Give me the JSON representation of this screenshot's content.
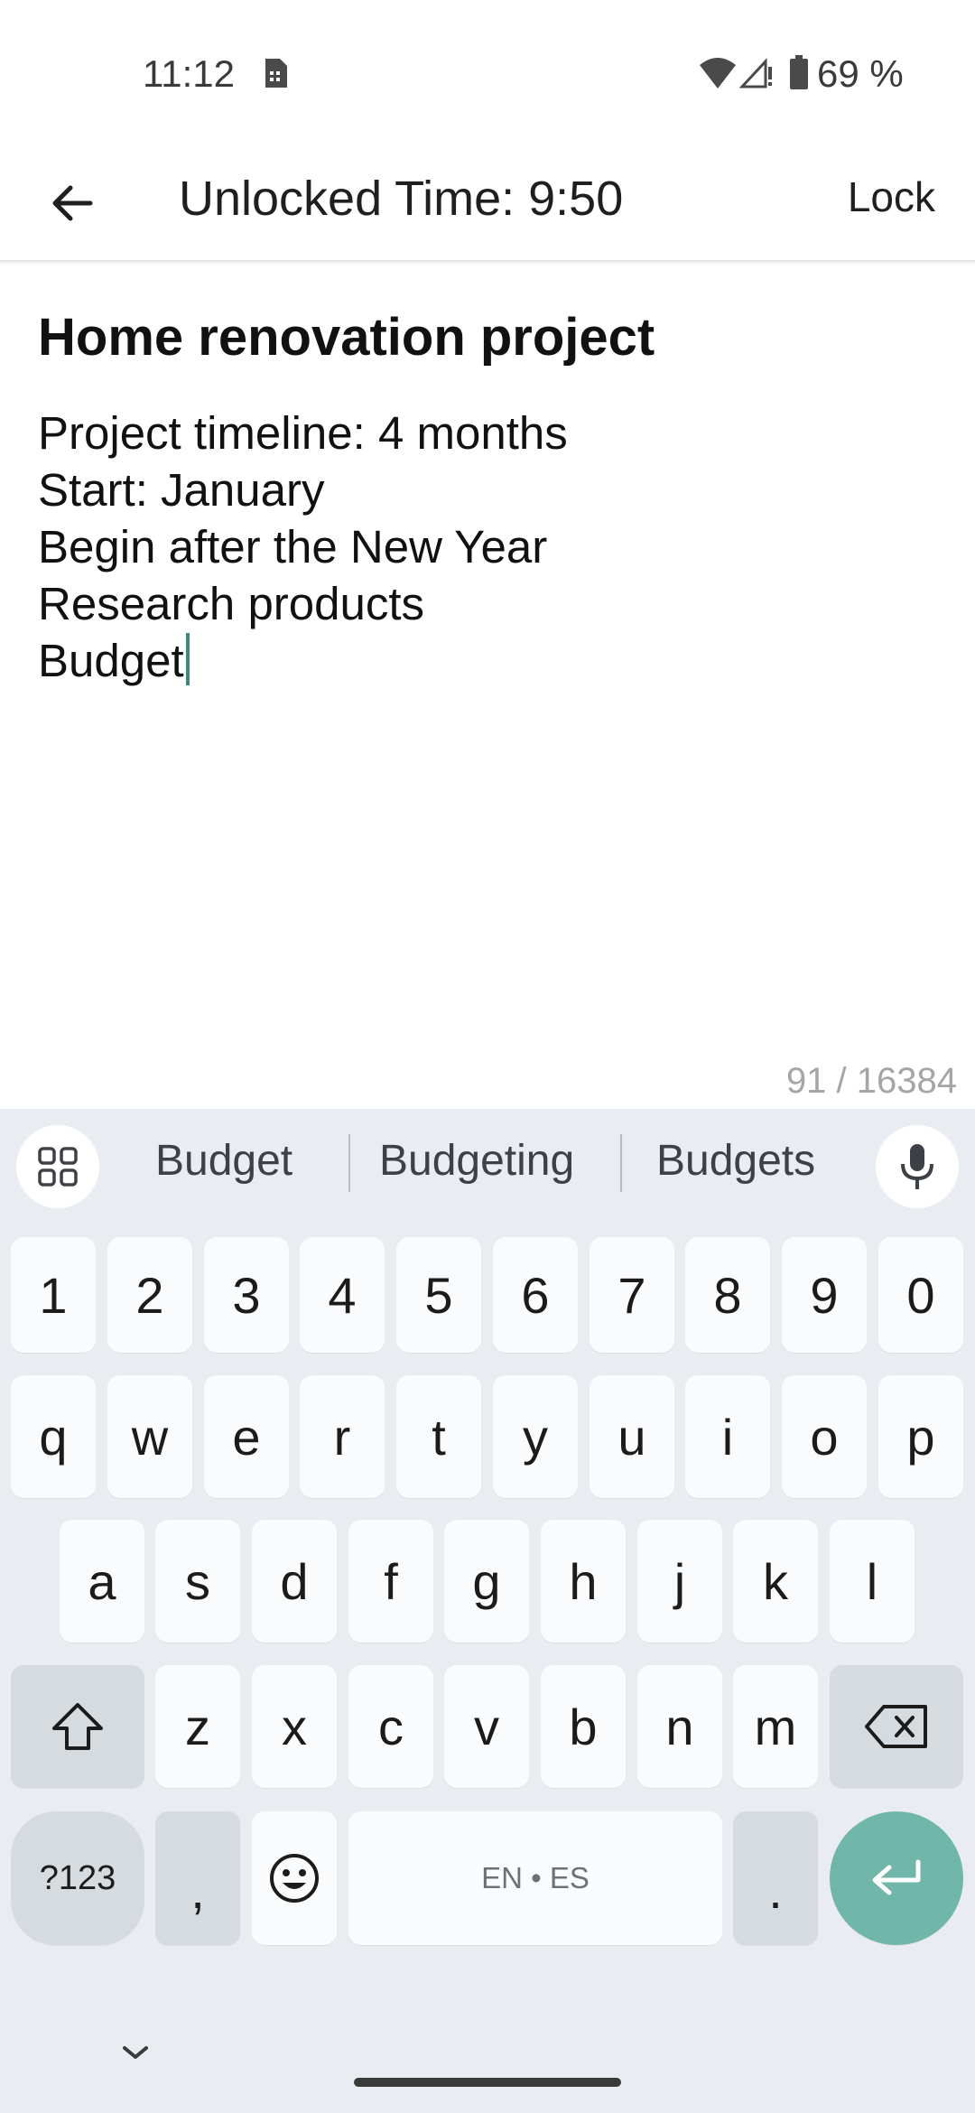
{
  "status_bar": {
    "time": "11:12",
    "battery": "69 %",
    "icons": [
      "sim-card-icon",
      "wifi-icon",
      "signal-icon",
      "battery-icon"
    ]
  },
  "app_bar": {
    "title": "Unlocked Time: 9:50",
    "lock_label": "Lock",
    "back_icon": "arrow-left-icon"
  },
  "note": {
    "title": "Home renovation project",
    "lines": [
      "Project timeline: 4 months",
      "Start: January",
      "Begin after the New Year",
      "Research products",
      "Budget"
    ],
    "char_count": "91 / 16384"
  },
  "keyboard": {
    "suggestions": [
      "Budget",
      "Budgeting",
      "Budgets"
    ],
    "number_row": [
      "1",
      "2",
      "3",
      "4",
      "5",
      "6",
      "7",
      "8",
      "9",
      "0"
    ],
    "row1": [
      "q",
      "w",
      "e",
      "r",
      "t",
      "y",
      "u",
      "i",
      "o",
      "p"
    ],
    "row2": [
      "a",
      "s",
      "d",
      "f",
      "g",
      "h",
      "j",
      "k",
      "l"
    ],
    "row3": [
      "z",
      "x",
      "c",
      "v",
      "b",
      "n",
      "m"
    ],
    "symbols_label": "?123",
    "comma": ",",
    "space_label": "EN • ES",
    "period": ".",
    "accent_color": "#70b6a9"
  }
}
